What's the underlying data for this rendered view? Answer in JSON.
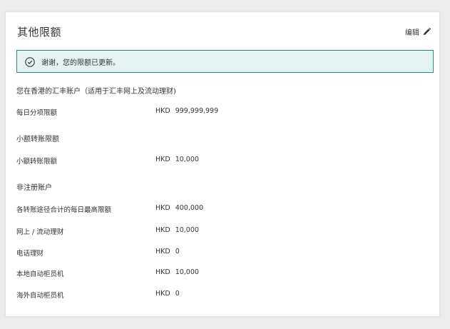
{
  "header": {
    "title": "其他限额",
    "edit_label": "编辑"
  },
  "alert": {
    "message": "谢谢，您的限额已更新。",
    "accent": "#2f8a85",
    "background": "#e5f2f2"
  },
  "account_heading": "您在香港的汇丰账户（适用于汇丰网上及流动理财)",
  "daily_item_limit": {
    "label": "每日分项限额",
    "currency": "HKD",
    "value": "999,999,999"
  },
  "small_transfer": {
    "heading": "小额转账限额",
    "label": "小额转账限额",
    "currency": "HKD",
    "value": "10,000"
  },
  "non_registered": {
    "heading": "非注册账户",
    "rows": [
      {
        "label": "各转账途径合计的每日最高限额",
        "currency": "HKD",
        "value": "400,000"
      },
      {
        "label": "网上 / 流动理财",
        "currency": "HKD",
        "value": "10,000"
      },
      {
        "label": "电话理财",
        "currency": "HKD",
        "value": "0"
      },
      {
        "label": "本地自动柜员机",
        "currency": "HKD",
        "value": "10,000"
      },
      {
        "label": "海外自动柜员机",
        "currency": "HKD",
        "value": "0"
      }
    ]
  },
  "icons": {
    "edit": "pencil-icon",
    "success": "check-circle-icon"
  }
}
